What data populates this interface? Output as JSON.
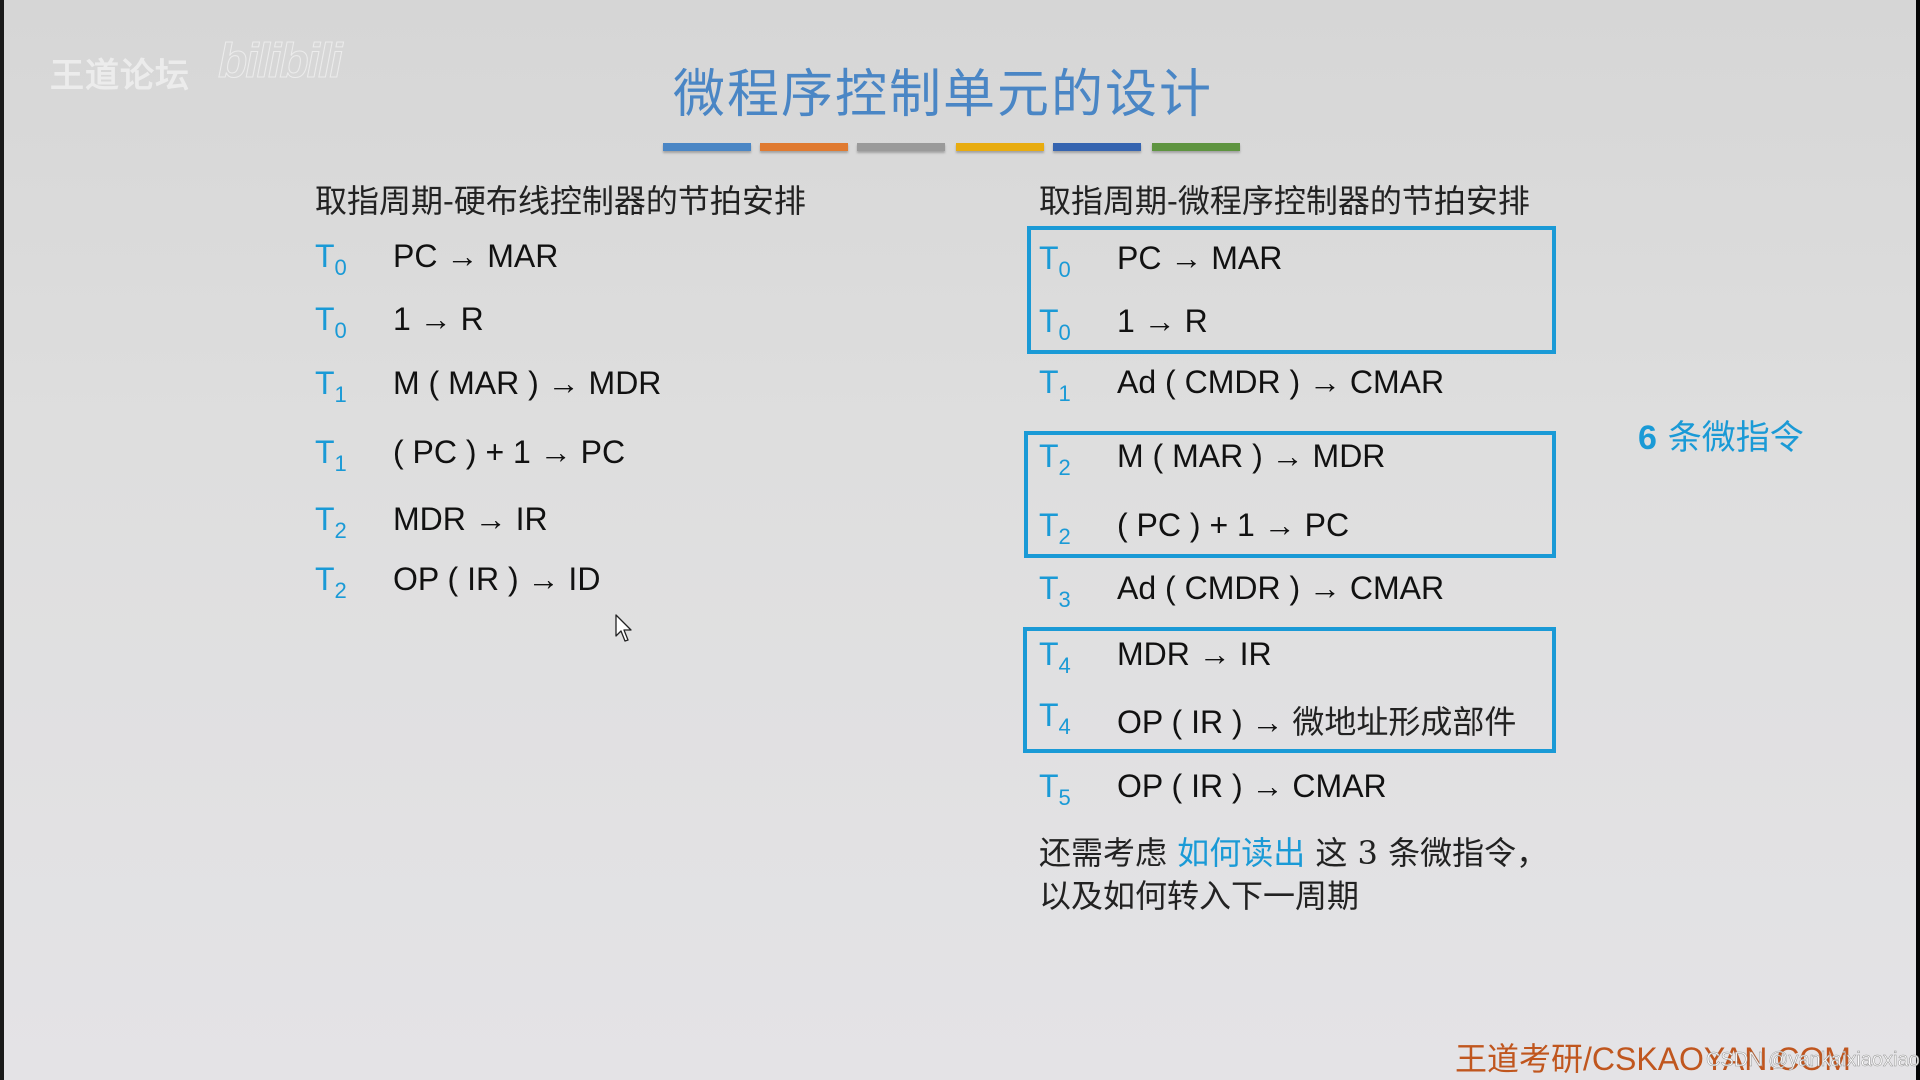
{
  "watermark": {
    "logo_text": "王道论坛",
    "logo_bili": "bilibili"
  },
  "title": "微程序控制单元的设计",
  "accent_bars": [
    "#4a86c5",
    "#e07a30",
    "#9a9a9a",
    "#e8ac10",
    "#3564b0",
    "#5e9440"
  ],
  "left": {
    "heading": "取指周期-硬布线控制器的节拍安排",
    "rows": [
      {
        "t": "T",
        "sub": "0",
        "expr": "PC → MAR"
      },
      {
        "t": "T",
        "sub": "0",
        "expr": "1 → R"
      },
      {
        "t": "T",
        "sub": "1",
        "expr": "M ( MAR ) → MDR"
      },
      {
        "t": "T",
        "sub": "1",
        "expr": "( PC ) + 1 → PC"
      },
      {
        "t": "T",
        "sub": "2",
        "expr": "MDR → IR"
      },
      {
        "t": "T",
        "sub": "2",
        "expr": "OP ( IR ) → ID"
      }
    ]
  },
  "right": {
    "heading": "取指周期-微程序控制器的节拍安排",
    "rows": [
      {
        "t": "T",
        "sub": "0",
        "expr": "PC → MAR"
      },
      {
        "t": "T",
        "sub": "0",
        "expr": "1 → R"
      },
      {
        "t": "T",
        "sub": "1",
        "expr": "Ad ( CMDR ) → CMAR"
      },
      {
        "t": "T",
        "sub": "2",
        "expr": "M ( MAR ) → MDR"
      },
      {
        "t": "T",
        "sub": "2",
        "expr": "( PC ) + 1 → PC"
      },
      {
        "t": "T",
        "sub": "3",
        "expr": "Ad ( CMDR ) → CMAR"
      },
      {
        "t": "T",
        "sub": "4",
        "expr": "MDR → IR"
      },
      {
        "t": "T",
        "sub": "4",
        "expr": "OP ( IR ) → ",
        "expr_cn": "微地址形成部件"
      },
      {
        "t": "T",
        "sub": "5",
        "expr": "OP ( IR ) → CMAR"
      }
    ],
    "note": {
      "line1_pre": "还需考虑 ",
      "line1_hl": "如何读出",
      "line1_post": " 这 3 条微指令，",
      "line2": "以及如何转入下一周期"
    }
  },
  "side_note": {
    "num": "6",
    "text": " 条微指令"
  },
  "footer": "王道考研/CSKAOYAN.COM",
  "credit": "CSDN @yankaixiaoxiao",
  "colors": {
    "title": "#4a86c5",
    "accent": "#1a9ad6",
    "footer": "#c0561e"
  }
}
